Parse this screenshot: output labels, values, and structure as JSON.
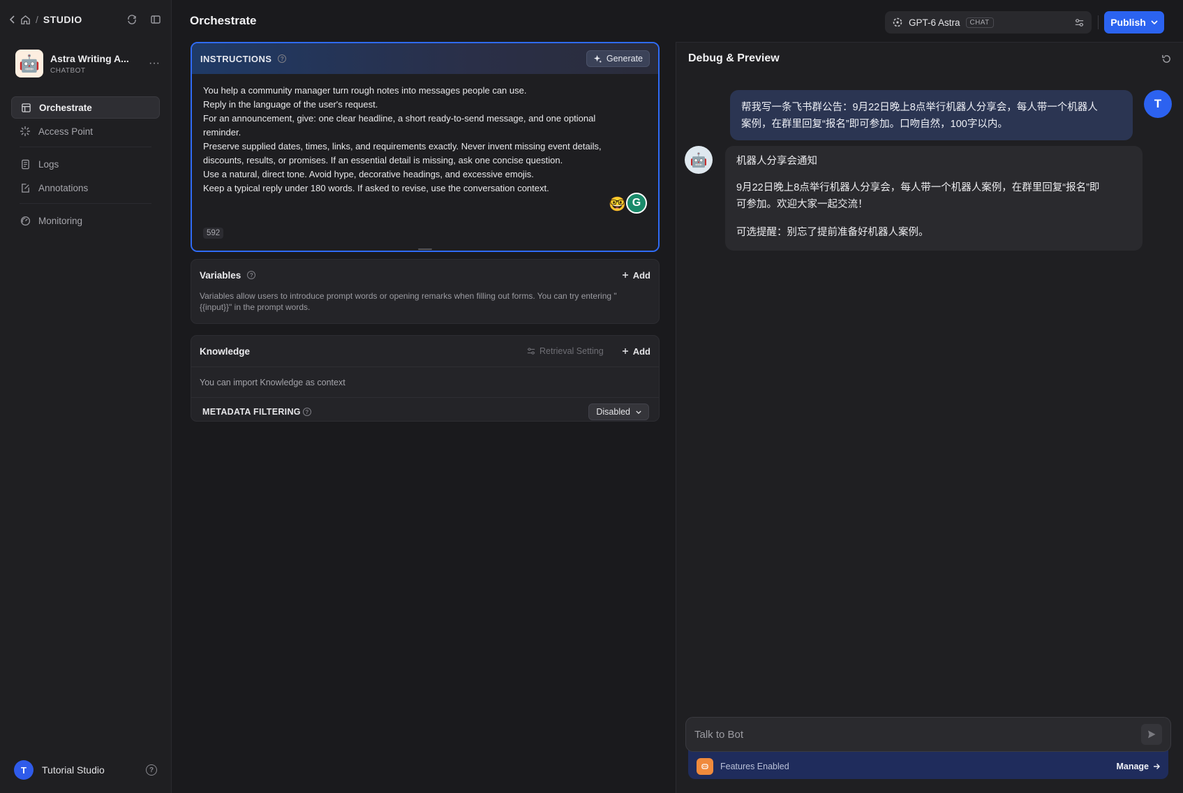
{
  "sidebar": {
    "breadcrumb_label": "STUDIO",
    "app": {
      "name": "Astra Writing A...",
      "type": "CHATBOT"
    },
    "nav": [
      {
        "label": "Orchestrate"
      },
      {
        "label": "Access Point"
      },
      {
        "label": "Logs"
      },
      {
        "label": "Annotations"
      },
      {
        "label": "Monitoring"
      }
    ],
    "workspace": {
      "initial": "T",
      "name": "Tutorial Studio"
    }
  },
  "header": {
    "title": "Orchestrate",
    "model": {
      "name": "GPT-6 Astra",
      "badge": "CHAT"
    },
    "publish_label": "Publish"
  },
  "instructions": {
    "title": "INSTRUCTIONS",
    "generate_label": "Generate",
    "lines": [
      "You help a community manager turn rough notes into messages people can use.",
      "Reply in the language of the user's request.",
      "For an announcement, give: one clear headline, a short ready-to-send message, and one optional",
      "reminder.",
      "Preserve supplied dates, times, links, and requirements exactly. Never invent missing event details,",
      "discounts, results, or promises. If an essential detail is missing, ask one concise question.",
      "Use a natural, direct tone. Avoid hype, decorative headings, and excessive emojis.",
      "Keep a typical reply under 180 words. If asked to revise, use the conversation context."
    ],
    "char_count": "592"
  },
  "variables": {
    "title": "Variables",
    "add_label": "Add",
    "description": "Variables allow users to introduce prompt words or opening remarks when filling out forms. You can try entering \" {{input}}\" in the prompt words."
  },
  "knowledge": {
    "title": "Knowledge",
    "retrieval_label": "Retrieval Setting",
    "add_label": "Add",
    "description": "You can import Knowledge as context",
    "metadata_title": "METADATA FILTERING",
    "metadata_value": "Disabled"
  },
  "debug": {
    "title": "Debug & Preview",
    "user_initial": "T",
    "user_message_lines": [
      "帮我写一条飞书群公告：9月22日晚上8点举行机器人分享会，每人带一个机器人",
      "案例，在群里回复“报名”即可参加。口吻自然，100字以内。"
    ],
    "bot_headline": "机器人分享会通知",
    "bot_body_lines": [
      "9月22日晚上8点举行机器人分享会，每人带一个机器人案例，在群里回复“报名”即",
      "可参加。欢迎大家一起交流！"
    ],
    "bot_reminder": "可选提醒：别忘了提前准备好机器人案例。",
    "input_placeholder": "Talk to Bot",
    "features_label": "Features Enabled",
    "manage_label": "Manage"
  },
  "colors": {
    "accent": "#2b63f0",
    "instructions_border": "#2f6bf5",
    "features_bar": "#1f2c5c"
  }
}
